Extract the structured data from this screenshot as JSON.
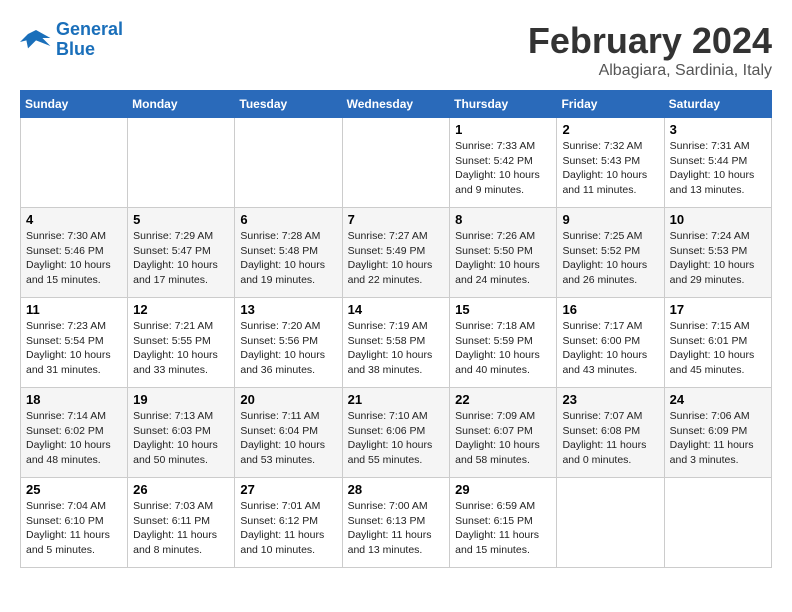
{
  "logo": {
    "line1": "General",
    "line2": "Blue"
  },
  "title": "February 2024",
  "location": "Albagiara, Sardinia, Italy",
  "weekdays": [
    "Sunday",
    "Monday",
    "Tuesday",
    "Wednesday",
    "Thursday",
    "Friday",
    "Saturday"
  ],
  "weeks": [
    [
      {
        "day": "",
        "info": ""
      },
      {
        "day": "",
        "info": ""
      },
      {
        "day": "",
        "info": ""
      },
      {
        "day": "",
        "info": ""
      },
      {
        "day": "1",
        "info": "Sunrise: 7:33 AM\nSunset: 5:42 PM\nDaylight: 10 hours and 9 minutes."
      },
      {
        "day": "2",
        "info": "Sunrise: 7:32 AM\nSunset: 5:43 PM\nDaylight: 10 hours and 11 minutes."
      },
      {
        "day": "3",
        "info": "Sunrise: 7:31 AM\nSunset: 5:44 PM\nDaylight: 10 hours and 13 minutes."
      }
    ],
    [
      {
        "day": "4",
        "info": "Sunrise: 7:30 AM\nSunset: 5:46 PM\nDaylight: 10 hours and 15 minutes."
      },
      {
        "day": "5",
        "info": "Sunrise: 7:29 AM\nSunset: 5:47 PM\nDaylight: 10 hours and 17 minutes."
      },
      {
        "day": "6",
        "info": "Sunrise: 7:28 AM\nSunset: 5:48 PM\nDaylight: 10 hours and 19 minutes."
      },
      {
        "day": "7",
        "info": "Sunrise: 7:27 AM\nSunset: 5:49 PM\nDaylight: 10 hours and 22 minutes."
      },
      {
        "day": "8",
        "info": "Sunrise: 7:26 AM\nSunset: 5:50 PM\nDaylight: 10 hours and 24 minutes."
      },
      {
        "day": "9",
        "info": "Sunrise: 7:25 AM\nSunset: 5:52 PM\nDaylight: 10 hours and 26 minutes."
      },
      {
        "day": "10",
        "info": "Sunrise: 7:24 AM\nSunset: 5:53 PM\nDaylight: 10 hours and 29 minutes."
      }
    ],
    [
      {
        "day": "11",
        "info": "Sunrise: 7:23 AM\nSunset: 5:54 PM\nDaylight: 10 hours and 31 minutes."
      },
      {
        "day": "12",
        "info": "Sunrise: 7:21 AM\nSunset: 5:55 PM\nDaylight: 10 hours and 33 minutes."
      },
      {
        "day": "13",
        "info": "Sunrise: 7:20 AM\nSunset: 5:56 PM\nDaylight: 10 hours and 36 minutes."
      },
      {
        "day": "14",
        "info": "Sunrise: 7:19 AM\nSunset: 5:58 PM\nDaylight: 10 hours and 38 minutes."
      },
      {
        "day": "15",
        "info": "Sunrise: 7:18 AM\nSunset: 5:59 PM\nDaylight: 10 hours and 40 minutes."
      },
      {
        "day": "16",
        "info": "Sunrise: 7:17 AM\nSunset: 6:00 PM\nDaylight: 10 hours and 43 minutes."
      },
      {
        "day": "17",
        "info": "Sunrise: 7:15 AM\nSunset: 6:01 PM\nDaylight: 10 hours and 45 minutes."
      }
    ],
    [
      {
        "day": "18",
        "info": "Sunrise: 7:14 AM\nSunset: 6:02 PM\nDaylight: 10 hours and 48 minutes."
      },
      {
        "day": "19",
        "info": "Sunrise: 7:13 AM\nSunset: 6:03 PM\nDaylight: 10 hours and 50 minutes."
      },
      {
        "day": "20",
        "info": "Sunrise: 7:11 AM\nSunset: 6:04 PM\nDaylight: 10 hours and 53 minutes."
      },
      {
        "day": "21",
        "info": "Sunrise: 7:10 AM\nSunset: 6:06 PM\nDaylight: 10 hours and 55 minutes."
      },
      {
        "day": "22",
        "info": "Sunrise: 7:09 AM\nSunset: 6:07 PM\nDaylight: 10 hours and 58 minutes."
      },
      {
        "day": "23",
        "info": "Sunrise: 7:07 AM\nSunset: 6:08 PM\nDaylight: 11 hours and 0 minutes."
      },
      {
        "day": "24",
        "info": "Sunrise: 7:06 AM\nSunset: 6:09 PM\nDaylight: 11 hours and 3 minutes."
      }
    ],
    [
      {
        "day": "25",
        "info": "Sunrise: 7:04 AM\nSunset: 6:10 PM\nDaylight: 11 hours and 5 minutes."
      },
      {
        "day": "26",
        "info": "Sunrise: 7:03 AM\nSunset: 6:11 PM\nDaylight: 11 hours and 8 minutes."
      },
      {
        "day": "27",
        "info": "Sunrise: 7:01 AM\nSunset: 6:12 PM\nDaylight: 11 hours and 10 minutes."
      },
      {
        "day": "28",
        "info": "Sunrise: 7:00 AM\nSunset: 6:13 PM\nDaylight: 11 hours and 13 minutes."
      },
      {
        "day": "29",
        "info": "Sunrise: 6:59 AM\nSunset: 6:15 PM\nDaylight: 11 hours and 15 minutes."
      },
      {
        "day": "",
        "info": ""
      },
      {
        "day": "",
        "info": ""
      }
    ]
  ]
}
